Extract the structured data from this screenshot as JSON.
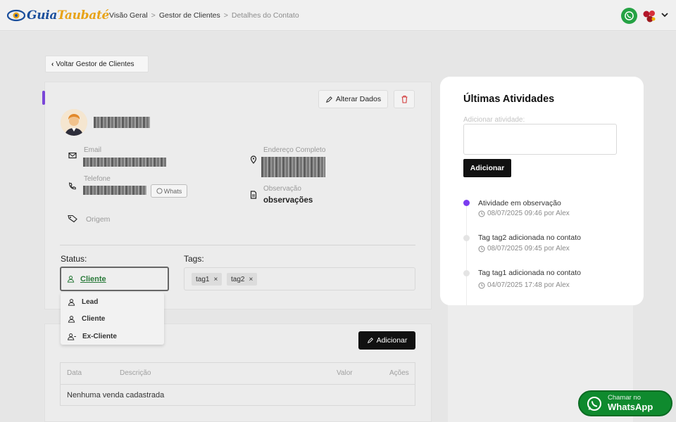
{
  "header": {
    "logo_main": "Guia",
    "logo_accent": "Taubaté",
    "breadcrumb": [
      "Visão Geral",
      "Gestor de Clientes",
      "Detalhes do Contato"
    ],
    "sep": ">"
  },
  "back_button": {
    "label": "Voltar Gestor de Clientes"
  },
  "contact": {
    "alter_label": "Alterar Dados",
    "email_label": "Email",
    "phone_label": "Telefone",
    "whats_label": "Whats",
    "origin_label": "Origem",
    "address_label": "Endereço Completo",
    "obs_label": "Observação",
    "obs_value": "observações"
  },
  "status": {
    "label": "Status:",
    "value": "Cliente",
    "options": [
      "Lead",
      "Cliente",
      "Ex-Cliente"
    ]
  },
  "tags": {
    "label": "Tags:",
    "items": [
      "tag1",
      "tag2"
    ],
    "remove": "×"
  },
  "sales": {
    "add_label": "Adicionar",
    "columns": [
      "Data",
      "Descrição",
      "Valor",
      "Ações"
    ],
    "empty": "Nenhuma venda cadastrada"
  },
  "activities": {
    "title": "Últimas Atividades",
    "input_placeholder": "Adicionar atividade:",
    "add_label": "Adicionar",
    "items": [
      {
        "title": "Atividade em observação",
        "meta": "08/07/2025 09:46 por Alex",
        "color": "#7a3cf0"
      },
      {
        "title": "Tag tag2 adicionada no contato",
        "meta": "08/07/2025 09:45 por Alex",
        "color": "#e2e2e2"
      },
      {
        "title": "Tag tag1 adicionada no contato",
        "meta": "04/07/2025 17:48 por Alex",
        "color": "#e2e2e2"
      }
    ]
  },
  "whatsapp_float": {
    "line1": "Chamar no",
    "line2": "WhatsApp"
  },
  "colors": {
    "accent": "#7a46d8",
    "whatsapp": "#25a244"
  }
}
